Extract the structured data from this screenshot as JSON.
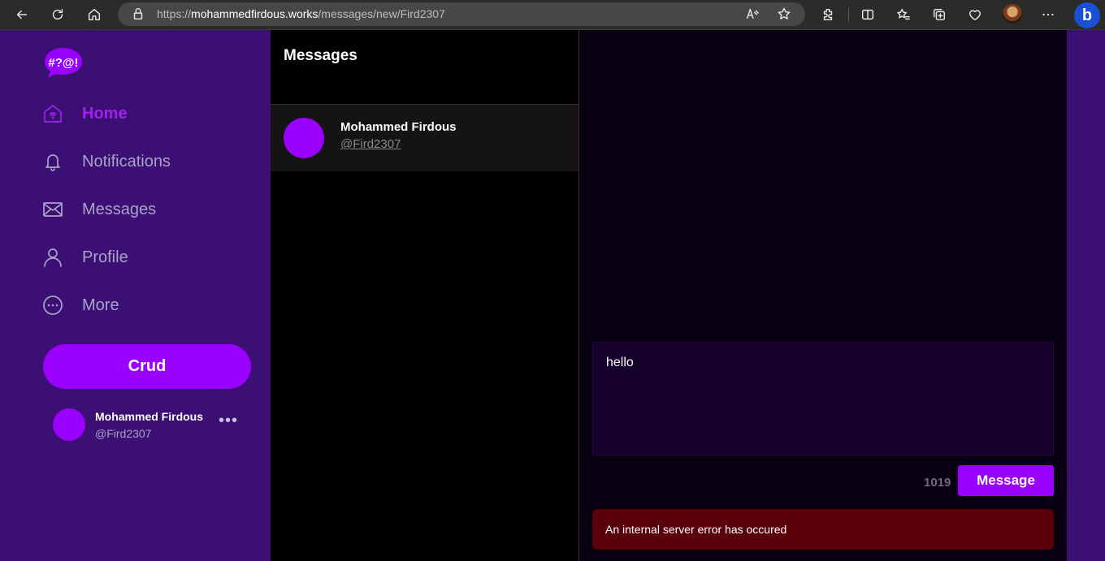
{
  "browser": {
    "url_prefix": "https://",
    "url_domain": "mohammedfirdous.works",
    "url_path": "/messages/new/Fird2307",
    "bing_label": "b"
  },
  "app": {
    "logo_text": "#?@!",
    "nav": [
      {
        "label": "Home",
        "icon": "home-icon",
        "active": true
      },
      {
        "label": "Notifications",
        "icon": "bell-icon",
        "active": false
      },
      {
        "label": "Messages",
        "icon": "mail-icon",
        "active": false
      },
      {
        "label": "Profile",
        "icon": "user-icon",
        "active": false
      },
      {
        "label": "More",
        "icon": "more-circle-icon",
        "active": false
      }
    ],
    "crud_label": "Crud",
    "current_user": {
      "name": "Mohammed Firdous",
      "handle": "@Fird2307",
      "menu": "•••"
    }
  },
  "messages": {
    "title": "Messages",
    "conversations": [
      {
        "name": "Mohammed Firdous",
        "handle": "@Fird2307"
      }
    ]
  },
  "chat": {
    "draft": "hello",
    "char_count": "1019",
    "send_label": "Message",
    "error": "An internal server error has occured"
  },
  "colors": {
    "accent": "#9900ff",
    "sidebar_bg": "#3b0f73",
    "error_bg": "#5a0008"
  }
}
